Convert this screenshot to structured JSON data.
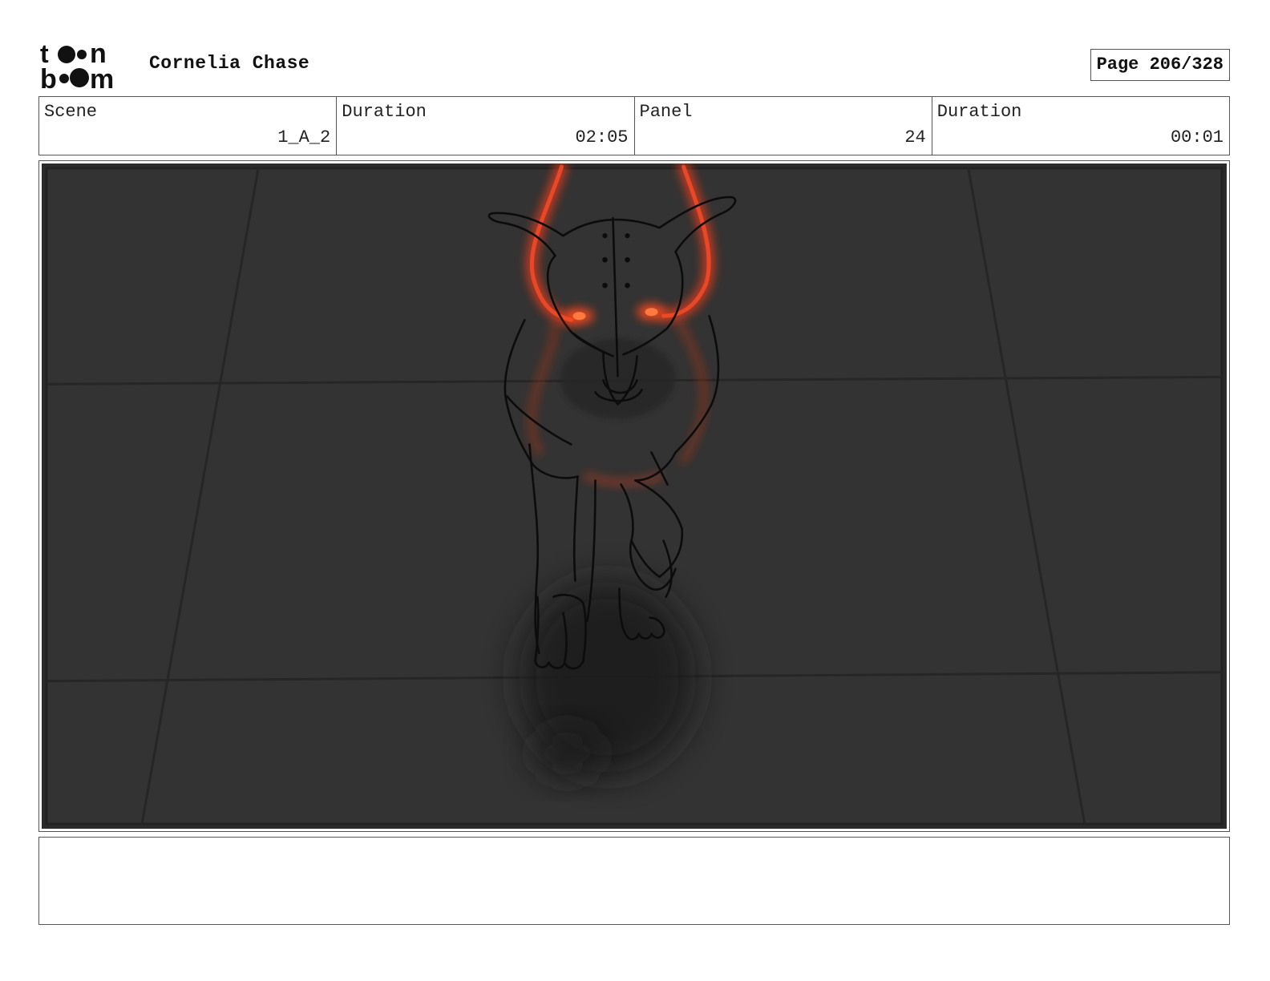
{
  "header": {
    "logo_text": "toon boom",
    "project_title": "Cornelia Chase",
    "page_label": "Page 206/328"
  },
  "info": {
    "scene_label": "Scene",
    "scene_value": "1_A_2",
    "scene_duration_label": "Duration",
    "scene_duration_value": "02:05",
    "panel_label": "Panel",
    "panel_value": "24",
    "panel_duration_label": "Duration",
    "panel_duration_value": "00:01"
  },
  "panel_image": {
    "description_icon": "dog-sketch-image",
    "background_color": "#333333",
    "line_color": "#111111",
    "glow_color": "#e8381c"
  },
  "notes": {
    "text": ""
  }
}
